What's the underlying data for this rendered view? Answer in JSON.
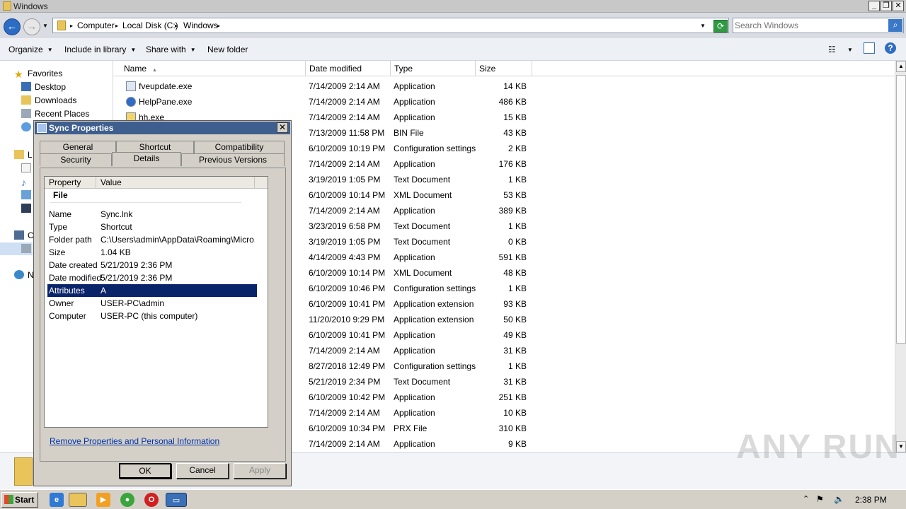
{
  "window": {
    "title": "Windows"
  },
  "address": {
    "crumbs": [
      "Computer",
      "Local Disk (C:)",
      "Windows"
    ]
  },
  "search": {
    "placeholder": "Search Windows"
  },
  "toolbar": {
    "organize": "Organize",
    "include": "Include in library",
    "share": "Share with",
    "new_folder": "New folder"
  },
  "nav": {
    "favorites": "Favorites",
    "desktop": "Desktop",
    "downloads": "Downloads",
    "recent": "Recent Places",
    "libraries_partial": "L",
    "computer_partial": "C",
    "network_partial": "N"
  },
  "columns": {
    "name": "Name",
    "date": "Date modified",
    "type": "Type",
    "size": "Size"
  },
  "files": [
    {
      "name": "fveupdate.exe",
      "date": "7/14/2009 2:14 AM",
      "type": "Application",
      "size": "14 KB"
    },
    {
      "name": "HelpPane.exe",
      "date": "7/14/2009 2:14 AM",
      "type": "Application",
      "size": "486 KB"
    },
    {
      "name": "hh.exe",
      "date": "7/14/2009 2:14 AM",
      "type": "Application",
      "size": "15 KB"
    },
    {
      "name": "",
      "date": "7/13/2009 11:58 PM",
      "type": "BIN File",
      "size": "43 KB"
    },
    {
      "name": "",
      "date": "6/10/2009 10:19 PM",
      "type": "Configuration settings",
      "size": "2 KB"
    },
    {
      "name": "",
      "date": "7/14/2009 2:14 AM",
      "type": "Application",
      "size": "176 KB"
    },
    {
      "name": "",
      "date": "3/19/2019 1:05 PM",
      "type": "Text Document",
      "size": "1 KB"
    },
    {
      "name": "",
      "date": "6/10/2009 10:14 PM",
      "type": "XML Document",
      "size": "53 KB"
    },
    {
      "name": "",
      "date": "7/14/2009 2:14 AM",
      "type": "Application",
      "size": "389 KB"
    },
    {
      "name": "",
      "date": "3/23/2019 6:58 PM",
      "type": "Text Document",
      "size": "1 KB"
    },
    {
      "name": "",
      "date": "3/19/2019 1:05 PM",
      "type": "Text Document",
      "size": "0 KB"
    },
    {
      "name": "",
      "date": "4/14/2009 4:43 PM",
      "type": "Application",
      "size": "591 KB"
    },
    {
      "name": "",
      "date": "6/10/2009 10:14 PM",
      "type": "XML Document",
      "size": "48 KB"
    },
    {
      "name": "",
      "date": "6/10/2009 10:46 PM",
      "type": "Configuration settings",
      "size": "1 KB"
    },
    {
      "name": "",
      "date": "6/10/2009 10:41 PM",
      "type": "Application extension",
      "size": "93 KB"
    },
    {
      "name": "",
      "date": "11/20/2010 9:29 PM",
      "type": "Application extension",
      "size": "50 KB"
    },
    {
      "name": "",
      "date": "6/10/2009 10:41 PM",
      "type": "Application",
      "size": "49 KB"
    },
    {
      "name": "",
      "date": "7/14/2009 2:14 AM",
      "type": "Application",
      "size": "31 KB"
    },
    {
      "name": "",
      "date": "8/27/2018 12:49 PM",
      "type": "Configuration settings",
      "size": "1 KB"
    },
    {
      "name": "",
      "date": "5/21/2019 2:34 PM",
      "type": "Text Document",
      "size": "31 KB"
    },
    {
      "name": "",
      "date": "6/10/2009 10:42 PM",
      "type": "Application",
      "size": "251 KB"
    },
    {
      "name": "",
      "date": "7/14/2009 2:14 AM",
      "type": "Application",
      "size": "10 KB"
    },
    {
      "name": "",
      "date": "6/10/2009 10:34 PM",
      "type": "PRX File",
      "size": "310 KB"
    },
    {
      "name": "",
      "date": "7/14/2009 2:14 AM",
      "type": "Application",
      "size": "9 KB"
    }
  ],
  "dialog": {
    "title": "Sync Properties",
    "tabs_row1": [
      "General",
      "Shortcut",
      "Compatibility"
    ],
    "tabs_row2": [
      "Security",
      "Details",
      "Previous Versions"
    ],
    "active_tab": "Details",
    "headers": {
      "property": "Property",
      "value": "Value"
    },
    "group": "File",
    "properties": [
      {
        "key": "Name",
        "value": "Sync.lnk"
      },
      {
        "key": "Type",
        "value": "Shortcut"
      },
      {
        "key": "Folder path",
        "value": "C:\\Users\\admin\\AppData\\Roaming\\Micro..."
      },
      {
        "key": "Size",
        "value": "1.04 KB"
      },
      {
        "key": "Date created",
        "value": "5/21/2019 2:36 PM"
      },
      {
        "key": "Date modified",
        "value": "5/21/2019 2:36 PM"
      },
      {
        "key": "Attributes",
        "value": "A"
      },
      {
        "key": "Owner",
        "value": "USER-PC\\admin"
      },
      {
        "key": "Computer",
        "value": "USER-PC (this computer)"
      }
    ],
    "selected_index": 6,
    "remove_link": "Remove Properties and Personal Information",
    "buttons": {
      "ok": "OK",
      "cancel": "Cancel",
      "apply": "Apply"
    }
  },
  "taskbar": {
    "start": "Start",
    "clock": "2:38 PM"
  },
  "watermark": "ANY RUN",
  "colors": {
    "selection": "#0a246a",
    "dialog_title": "#3e5e8e",
    "dialog_face": "#d4d0c8"
  }
}
